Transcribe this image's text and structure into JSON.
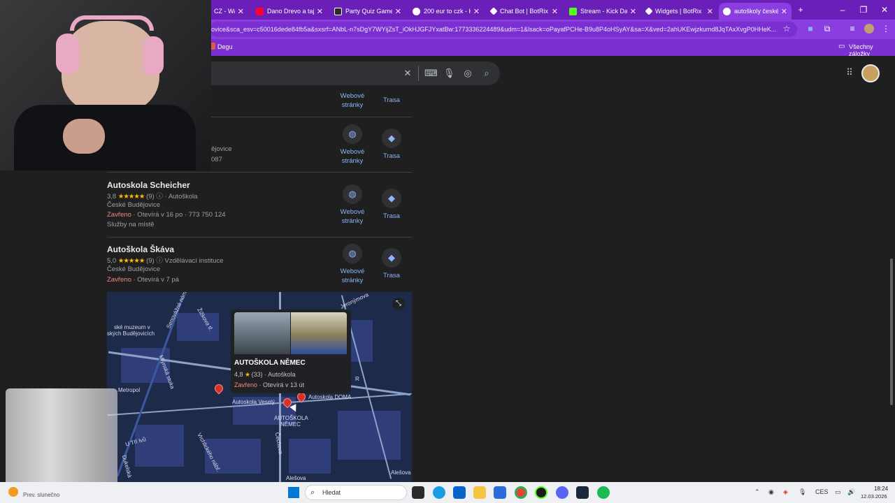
{
  "browser": {
    "tabs": [
      {
        "title": "CZ - Wa",
        "color": "#6a1fb8"
      },
      {
        "title": "Dano Drevo a taj",
        "color": "#ff0033"
      },
      {
        "title": "Party Quiz Game",
        "color": "#2b2b2b"
      },
      {
        "title": "200 eur to czk - H",
        "color": "#ffffff"
      },
      {
        "title": "Chat Bot | BotRix",
        "color": "#111111"
      },
      {
        "title": "Stream - Kick Das",
        "color": "#53fc18"
      },
      {
        "title": "Widgets | BotRix",
        "color": "#111111"
      },
      {
        "title": "autoškoly české b",
        "color": "#ffffff"
      }
    ],
    "url": "ovice&sca_esv=c50016dede84fb5a&sxsrf=ANbL-n7sDgY7WYijZsT_iOkHJGFJYxatBw:1773336224489&udm=1&lsack=oPayafPCHe-B9u8P4oHSyAY&sa=X&ved=2ahUKEwjzkumd8JqTAxXvgP0HHeK...",
    "bookmark": "Degu",
    "all_bookmarks": "Všechny záložky"
  },
  "results": [
    {
      "name": "",
      "lines": [],
      "website": "Webové stránky",
      "route": "Trasa"
    },
    {
      "name": "",
      "lines": [
        "ějovice",
        "087"
      ],
      "website": "Webové stránky",
      "route": "Trasa"
    },
    {
      "name": "Autoskola Scheicher",
      "rating": "3,8",
      "stars": "★★★★★",
      "reviews": "(9)",
      "category": "Autoškola",
      "city": "České Budějovice",
      "status": "Zavřeno",
      "hours": "· Otevírá v 16 po · 773 750 124",
      "extra": "Služby na místě",
      "website": "Webové stránky",
      "route": "Trasa"
    },
    {
      "name": "Autoškola Škáva",
      "rating": "5,0",
      "stars": "★★★★★",
      "reviews": "(9)",
      "category": "Vzdělávací instituce",
      "city": "České Budějovice",
      "status": "Zavřeno",
      "hours": "· Otevírá v 7 pá",
      "website": "Webové stránky",
      "route": "Trasa"
    }
  ],
  "map": {
    "card": {
      "name": "AUTOŠKOLA NĚMEC",
      "rating": "4,8",
      "star": "★",
      "reviews": "(33)",
      "category": "· Autoškola",
      "status": "Zavřeno",
      "hours": "· Otevírá v 13 út"
    },
    "labels": {
      "museum": "ské muzeum v",
      "museum2": "ských Budějovicích",
      "street1": "Senovážné nám.",
      "street2": "Žižkova tř.",
      "stoka": "Mlýnská stoka",
      "metropol": "Metropol",
      "vesely": "Autoskola Veselý",
      "doma": "Autoskola DOMA",
      "nemec1": "AUTOŠKOLA",
      "nemec2": "NĚMEC",
      "cechova": "Čechova",
      "trilvu": "U Tří lvů",
      "dukelska": "Dukelská",
      "vrchlick": "Vrchlického nábř.",
      "jeronym": "Jeronýmova",
      "alesova": "Alešova",
      "alesova2": "Alešova",
      "r": "R"
    }
  },
  "taskbar": {
    "search": "Hledat",
    "weather": "Prev. slunečno",
    "lang": "CES",
    "time": "18:24",
    "date": "12.03.2026"
  },
  "icons": {
    "search": "search-icon",
    "mic": "microphone-icon",
    "lens": "lens-icon",
    "keyboard": "keyboard-icon",
    "clear": "close-icon"
  }
}
